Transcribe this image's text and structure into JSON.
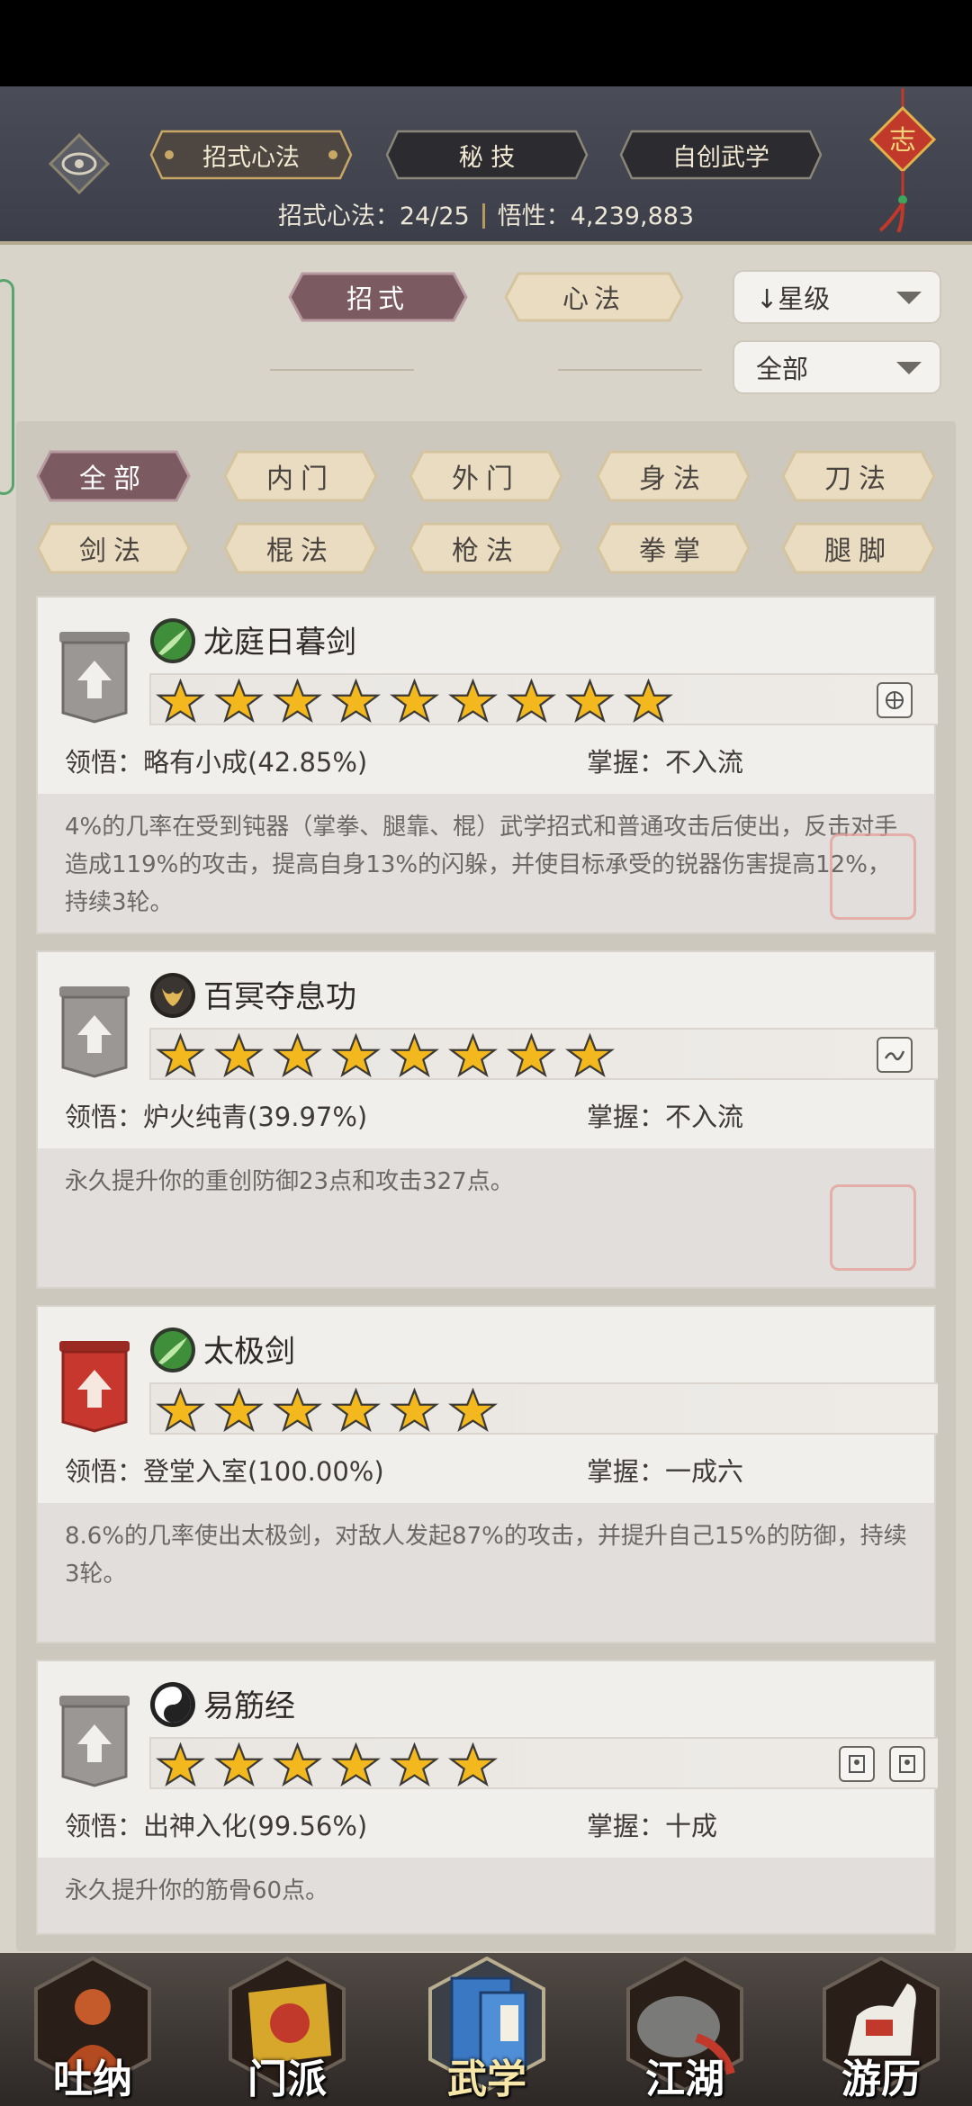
{
  "header": {
    "tabs": [
      {
        "label": "招式心法",
        "active": true
      },
      {
        "label": "秘 技",
        "active": false
      },
      {
        "label": "自创武学",
        "active": false
      }
    ],
    "count_label": "招式心法：",
    "count_value": "24/25",
    "insight_label": "悟性：",
    "insight_value": "4,239,883",
    "knot_char": "志"
  },
  "filters": {
    "type_tabs": [
      {
        "label": "招式",
        "active": true
      },
      {
        "label": "心法",
        "active": false
      }
    ],
    "sort_dropdown": "↓星级",
    "scope_dropdown": "全部"
  },
  "categories": [
    {
      "label": "全部",
      "active": true
    },
    {
      "label": "内门",
      "active": false
    },
    {
      "label": "外门",
      "active": false
    },
    {
      "label": "身法",
      "active": false
    },
    {
      "label": "刀法",
      "active": false
    },
    {
      "label": "剑法",
      "active": false
    },
    {
      "label": "棍法",
      "active": false
    },
    {
      "label": "枪法",
      "active": false
    },
    {
      "label": "拳掌",
      "active": false
    },
    {
      "label": "腿脚",
      "active": false
    }
  ],
  "skills": [
    {
      "name": "龙庭日暮剑",
      "icon": "sword-icon",
      "stars": 9,
      "badge": "gray",
      "comprehension_label": "领悟：",
      "comprehension": "略有小成(42.85%)",
      "mastery_label": "掌握：",
      "mastery": "不入流",
      "description": "4%的几率在受到钝器（掌拳、腿靠、棍）武学招式和普通攻击后使出，反击对手造成119%的攻击，提高自身13%的闪躲，并使目标承受的锐器伤害提高12%，持续3轮。"
    },
    {
      "name": "百冥夺息功",
      "icon": "palm-icon",
      "stars": 8,
      "badge": "gray",
      "comprehension_label": "领悟：",
      "comprehension": "炉火纯青(39.97%)",
      "mastery_label": "掌握：",
      "mastery": "不入流",
      "description": "永久提升你的重创防御23点和攻击327点。"
    },
    {
      "name": "太极剑",
      "icon": "sword-icon",
      "stars": 6,
      "badge": "red",
      "comprehension_label": "领悟：",
      "comprehension": "登堂入室(100.00%)",
      "mastery_label": "掌握：",
      "mastery": "一成六",
      "description": "8.6%的几率使出太极剑，对敌人发起87%的攻击，并提升自己15%的防御，持续3轮。"
    },
    {
      "name": "易筋经",
      "icon": "yin-yang-icon",
      "stars": 6,
      "badge": "gray",
      "comprehension_label": "领悟：",
      "comprehension": "出神入化(99.56%)",
      "mastery_label": "掌握：",
      "mastery": "十成",
      "description": "永久提升你的筋骨60点。"
    }
  ],
  "nav": [
    {
      "label": "吐纳",
      "active": false
    },
    {
      "label": "门派",
      "active": false
    },
    {
      "label": "武学",
      "active": true
    },
    {
      "label": "江湖",
      "active": false
    },
    {
      "label": "游历",
      "active": false
    }
  ],
  "colors": {
    "header_bg": "#43454f",
    "active_pill": "#7b5a62",
    "inactive_pill": "#e9dcc0",
    "star": "#f2b81e",
    "red_badge": "#c8372d"
  }
}
